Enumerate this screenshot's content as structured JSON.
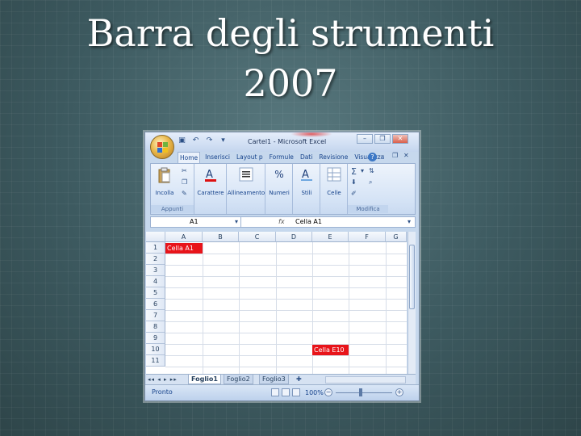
{
  "slide": {
    "title_line1": "Barra degli strumenti",
    "title_line2": "2007"
  },
  "window": {
    "title": "Cartel1 - Microsoft Excel",
    "controls": {
      "minimize": "–",
      "restore": "❐",
      "close": "✕"
    },
    "tab_controls": {
      "minimize": "–",
      "restore": "❐",
      "close": "✕"
    },
    "help": "?"
  },
  "tabs": [
    "Home",
    "Inserisci",
    "Layout p",
    "Formule",
    "Dati",
    "Revisione",
    "Visualizza"
  ],
  "ribbon": {
    "paste_label": "Incolla",
    "clipboard_group": "Appunti",
    "font_label": "Carattere",
    "align_label": "Allineamento",
    "number_label": "Numeri",
    "styles_label": "Stili",
    "cells_label": "Celle",
    "editing_group": "Modifica",
    "sigma": "Σ",
    "dropdown_arrow": "▾",
    "percent": "%"
  },
  "formula_bar": {
    "name_box": "A1",
    "fx": "fx",
    "value": "Cella A1"
  },
  "sheet": {
    "columns": [
      "A",
      "B",
      "C",
      "D",
      "E",
      "F",
      "G"
    ],
    "rows": [
      "1",
      "2",
      "3",
      "4",
      "5",
      "6",
      "7",
      "8",
      "9",
      "10",
      "11"
    ],
    "cell_a1": "Cella A1",
    "cell_e10": "Cella E10",
    "highlight_color": "#e8141a"
  },
  "sheet_tabs": {
    "nav": "◂◂ ◂ ▸ ▸▸",
    "tabs": [
      "Foglio1",
      "Foglio2",
      "Foglio3"
    ]
  },
  "status": {
    "text": "Pronto",
    "zoom": "100%",
    "minus": "−",
    "plus": "+"
  }
}
